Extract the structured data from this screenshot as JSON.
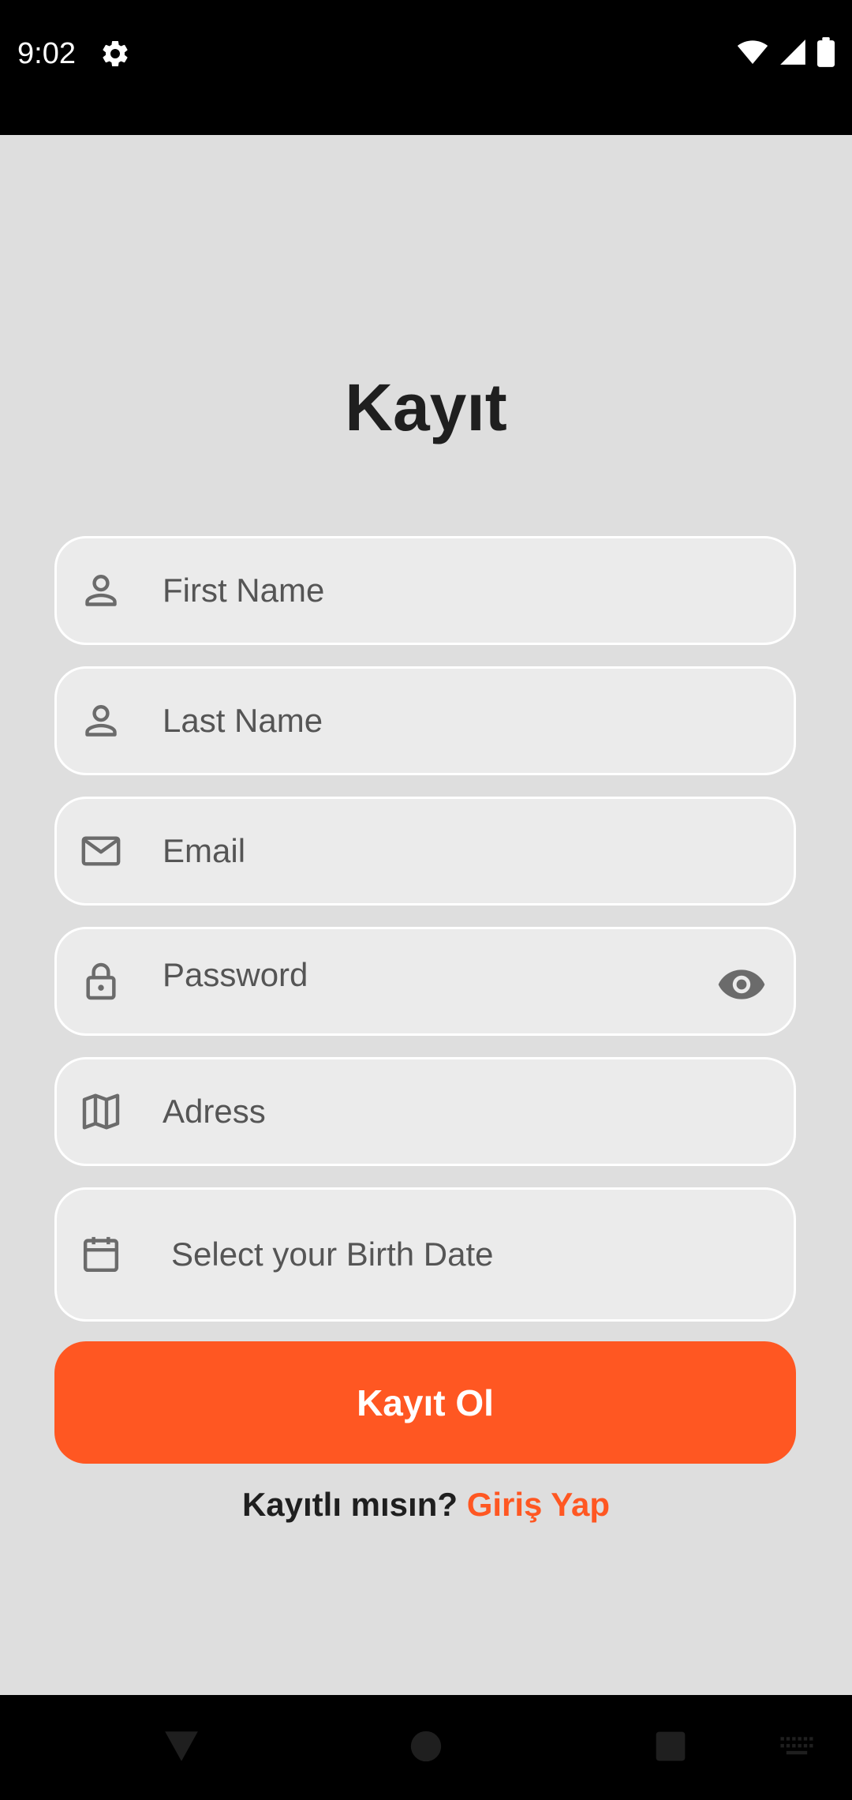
{
  "status_bar": {
    "time": "9:02",
    "icons": [
      "gear-icon",
      "wifi-icon",
      "signal-icon",
      "battery-icon"
    ]
  },
  "page": {
    "title": "Kayıt"
  },
  "form": {
    "first_name": {
      "placeholder": "First Name",
      "icon": "person-icon"
    },
    "last_name": {
      "placeholder": "Last Name",
      "icon": "person-icon"
    },
    "email": {
      "placeholder": "Email",
      "icon": "mail-icon"
    },
    "password": {
      "placeholder": "Password",
      "icon": "lock-icon",
      "toggle_icon": "eye-icon"
    },
    "address": {
      "placeholder": "Adress",
      "icon": "map-icon"
    },
    "birth_date": {
      "placeholder": "Select your Birth Date",
      "icon": "calendar-icon"
    }
  },
  "actions": {
    "register_label": "Kayıt Ol",
    "login_prompt": "Kayıtlı mısın?",
    "login_link": "Giriş Yap"
  },
  "nav_bar": {
    "icons": [
      "back-icon",
      "home-icon",
      "recents-icon",
      "keyboard-icon"
    ]
  },
  "colors": {
    "accent": "#ff5722",
    "background": "#dedede",
    "field_background": "#ebebeb",
    "text_dark": "#1f1f1f",
    "placeholder": "#555555"
  }
}
